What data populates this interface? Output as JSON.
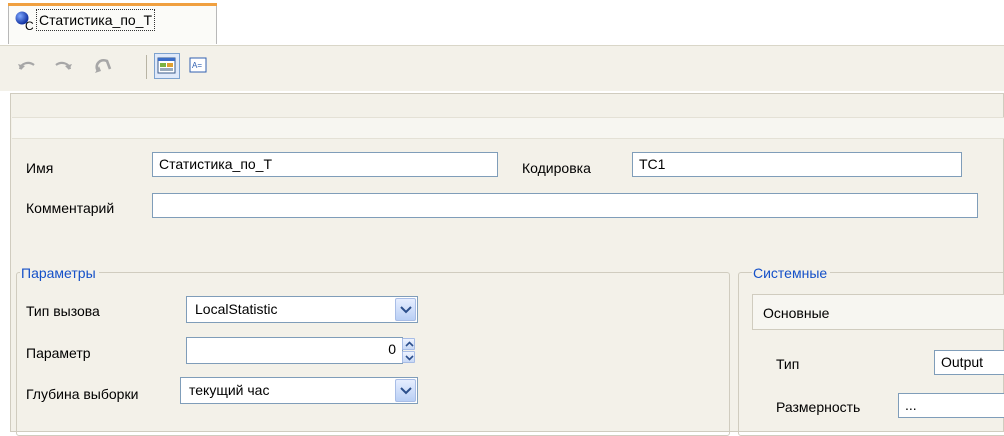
{
  "tab": {
    "label": "Статистика_по_Т",
    "icon": "component-icon"
  },
  "toolbar": {
    "buttons": [
      "undo-icon",
      "redo-icon",
      "refresh-icon",
      "form-view-icon",
      "text-view-icon"
    ]
  },
  "general": {
    "name_label": "Имя",
    "name_value": "Статистика_по_Т",
    "encoding_label": "Кодировка",
    "encoding_value": "TC1",
    "comment_label": "Комментарий",
    "comment_value": ""
  },
  "params": {
    "title": "Параметры",
    "call_type_label": "Тип вызова",
    "call_type_value": "LocalStatistic",
    "parameter_label": "Параметр",
    "parameter_value": "0",
    "depth_label": "Глубина выборки",
    "depth_value": "текущий час"
  },
  "system": {
    "title": "Системные",
    "basic_label": "Основные",
    "type_label": "Тип",
    "type_value": "Output",
    "dimension_label": "Размерность",
    "dimension_value": "..."
  },
  "colors": {
    "group_title": "#1450c8",
    "panel_bg": "#f3f1e9",
    "tab_accent": "#f0a040"
  }
}
